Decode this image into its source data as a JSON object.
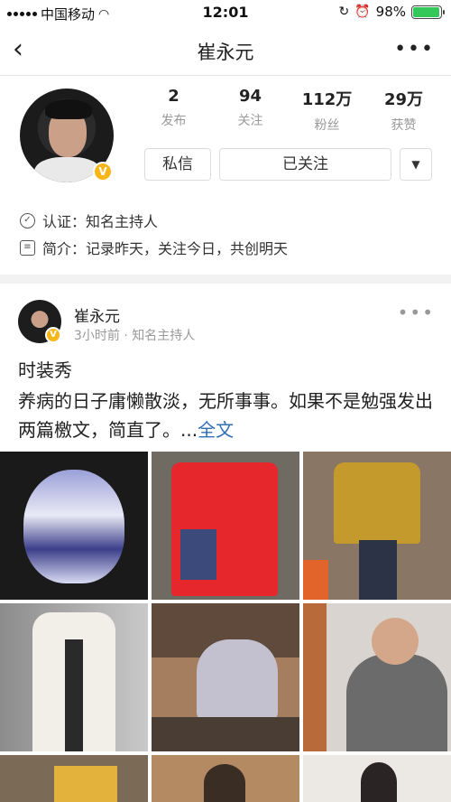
{
  "status_bar": {
    "carrier": "中国移动",
    "time": "12:01",
    "battery": "98%",
    "battery_level": 0.98
  },
  "nav": {
    "title": "崔永元",
    "back_icon": "chevron-left-icon",
    "more_icon": "more-icon"
  },
  "profile": {
    "stats": [
      {
        "value": "2",
        "label": "发布"
      },
      {
        "value": "94",
        "label": "关注"
      },
      {
        "value": "112万",
        "label": "粉丝"
      },
      {
        "value": "29万",
        "label": "获赞"
      }
    ],
    "message_label": "私信",
    "follow_label": "已关注",
    "verify_text": "认证：知名主持人",
    "bio_text": "简介：记录昨天，关注今日，共创明天",
    "badge": "V"
  },
  "post": {
    "author": "崔永元",
    "time": "3小时前",
    "source": "知名主持人",
    "title": "时装秀",
    "body": "养病的日子庸懒散淡，无所事事。如果不是勉强发出两篇檄文，简直了。...",
    "full_text_link": "全文",
    "images": [
      "tiger jacket",
      "red jacket",
      "yellow jacket",
      "white coat",
      "painting at desk",
      "sewing",
      "room",
      "person",
      "person"
    ]
  },
  "colors": {
    "link": "#2f6fb6",
    "badge": "#f6b61a",
    "battery": "#34c759",
    "muted": "#999999"
  }
}
